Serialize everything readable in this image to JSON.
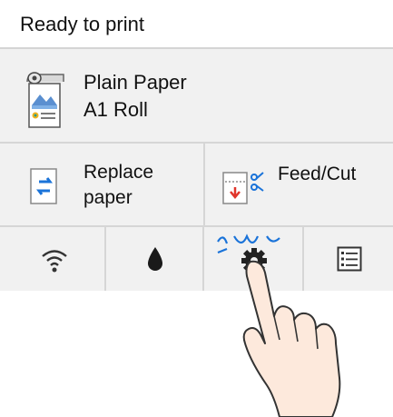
{
  "status": {
    "text": "Ready to print"
  },
  "media": {
    "paper_type": "Plain Paper",
    "paper_size": "A1 Roll",
    "icon": "paper-roll-icon"
  },
  "operations": {
    "replace": {
      "label_line1": "Replace",
      "label_line2": "paper",
      "icon": "replace-paper-icon"
    },
    "feed_cut": {
      "label": "Feed/Cut",
      "icon": "feed-cut-icon"
    }
  },
  "tabs": [
    {
      "name": "wifi",
      "icon": "wifi-icon"
    },
    {
      "name": "ink",
      "icon": "ink-drop-icon"
    },
    {
      "name": "settings",
      "icon": "gear-icon"
    },
    {
      "name": "menu",
      "icon": "list-icon"
    }
  ],
  "colors": {
    "accent_blue": "#1a73d9",
    "red": "#e0352b",
    "panel_bg": "#f1f1f1",
    "divider": "#d6d6d6"
  }
}
